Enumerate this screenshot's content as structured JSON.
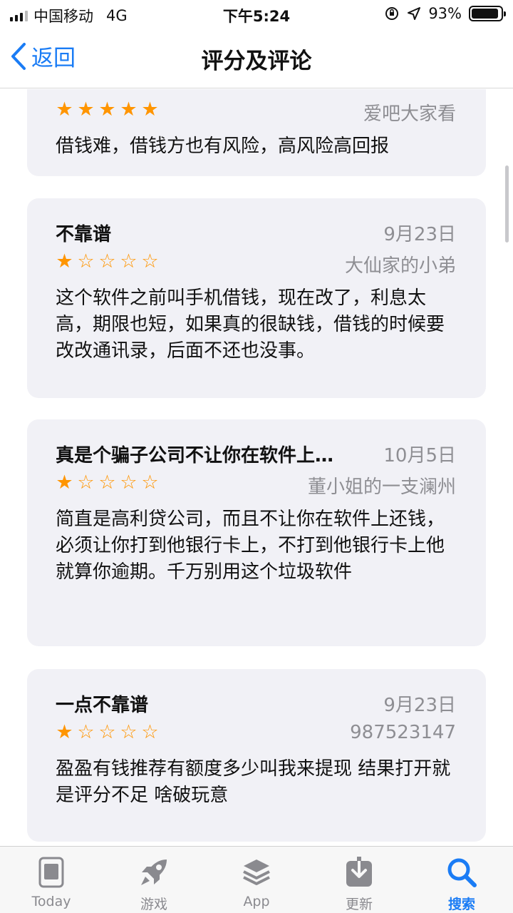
{
  "status_bar": {
    "carrier": "中国移动",
    "network": "4G",
    "time": "下午5:24",
    "battery_text": "93%",
    "battery_level": 0.93
  },
  "nav": {
    "back_label": "返回",
    "title": "评分及评论"
  },
  "reviews": [
    {
      "title": "",
      "date": "",
      "author": "爱吧大家看",
      "rating": 5,
      "body": "借钱难，借钱方也有风险，高风险高回报"
    },
    {
      "title": "不靠谱",
      "date": "9月23日",
      "author": "大仙家的小弟",
      "rating": 1,
      "body": "这个软件之前叫手机借钱，现在改了，利息太高，期限也短，如果真的很缺钱，借钱的时候要改改通讯录，后面不还也没事。"
    },
    {
      "title": "真是个骗子公司不让你在软件上…",
      "date": "10月5日",
      "author": "董小姐的一支澜州",
      "rating": 1,
      "body": "简直是高利贷公司，而且不让你在软件上还钱，必须让你打到他银行卡上，不打到他银行卡上他就算你逾期。千万别用这个垃圾软件"
    },
    {
      "title": "一点不靠谱",
      "date": "9月23日",
      "author": "987523147",
      "rating": 1,
      "body": "盈盈有钱推荐有额度多少叫我来提现 结果打开就是评分不足 啥破玩意"
    }
  ],
  "tabs": [
    {
      "label": "Today",
      "icon": "today-icon",
      "active": false
    },
    {
      "label": "游戏",
      "icon": "rocket-icon",
      "active": false
    },
    {
      "label": "App",
      "icon": "layers-icon",
      "active": false
    },
    {
      "label": "更新",
      "icon": "download-icon",
      "active": false
    },
    {
      "label": "搜索",
      "icon": "search-icon",
      "active": true
    }
  ],
  "colors": {
    "accent": "#1a7cf5",
    "star": "#ff9500",
    "card_bg": "#f1f1f6",
    "secondary_text": "#8e8e93"
  }
}
